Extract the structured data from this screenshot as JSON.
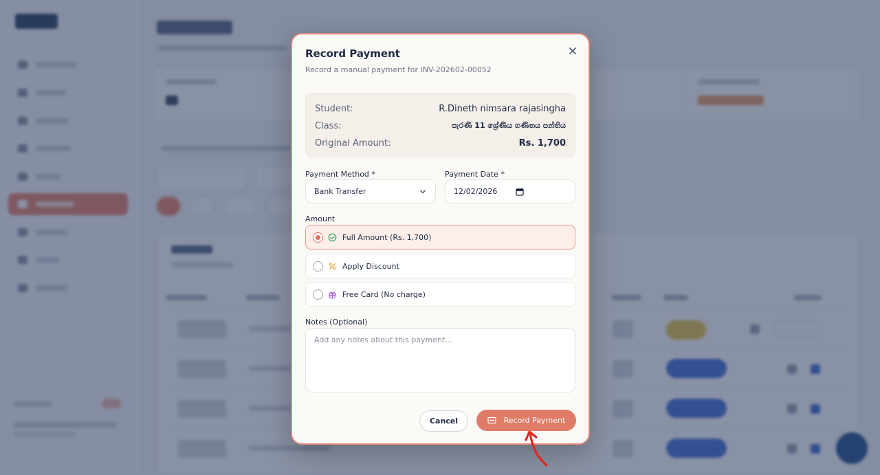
{
  "modal": {
    "title": "Record Payment",
    "subtitle": "Record a manual payment for INV-202602-00052",
    "info": {
      "student_label": "Student:",
      "student_value": "R.Dineth nimsara rajasingha",
      "class_label": "Class:",
      "class_value": "පැරණි 11 ශ්‍රේණිය ගණිතය පන්තිය",
      "amount_label": "Original Amount:",
      "amount_value": "Rs. 1,700"
    },
    "payment_method": {
      "label": "Payment Method *",
      "value": "Bank Transfer"
    },
    "payment_date": {
      "label": "Payment Date *",
      "value": "12/02/2026"
    },
    "amount": {
      "label": "Amount",
      "options": [
        {
          "label": "Full Amount (Rs. 1,700)",
          "selected": true,
          "icon": "check-circle-icon"
        },
        {
          "label": "Apply Discount",
          "selected": false,
          "icon": "percent-icon"
        },
        {
          "label": "Free Card (No charge)",
          "selected": false,
          "icon": "gift-icon"
        }
      ]
    },
    "notes": {
      "label": "Notes (Optional)",
      "placeholder": "Add any notes about this payment..."
    },
    "cancel_label": "Cancel",
    "submit_label": "Record Payment"
  },
  "colors": {
    "accent": "#e07b66",
    "modal_border": "#e1867a",
    "overlay": "#28375a",
    "check_green": "#3aa56b",
    "discount_orange": "#e8a33a",
    "gift_purple": "#a35ad8",
    "annotation_arrow": "#e0261f"
  }
}
